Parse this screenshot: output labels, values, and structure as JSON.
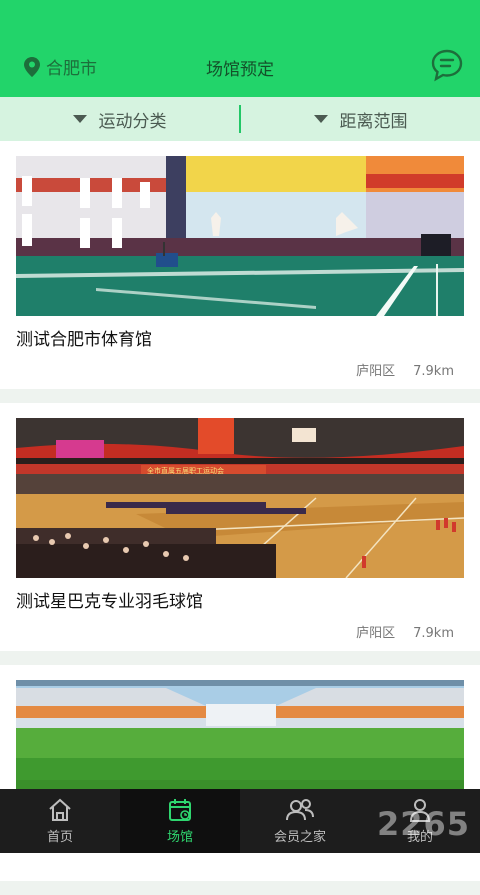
{
  "header": {
    "city": "合肥市",
    "title": "场馆预定"
  },
  "filters": {
    "sport_category": "运动分类",
    "distance_range": "距离范围"
  },
  "venues": [
    {
      "name": "测试合肥市体育馆",
      "district": "庐阳区",
      "distance": "7.9km"
    },
    {
      "name": "测试星巴克专业羽毛球馆",
      "district": "庐阳区",
      "distance": "7.9km"
    },
    {
      "name": "",
      "district": "",
      "distance": ""
    }
  ],
  "photo_banner": "全市直属五届职工运动会",
  "tabs": [
    {
      "label": "首页",
      "icon": "home-icon"
    },
    {
      "label": "场馆",
      "icon": "calendar-icon"
    },
    {
      "label": "会员之家",
      "icon": "members-icon"
    },
    {
      "label": "我的",
      "icon": "user-icon"
    }
  ],
  "watermark": "2265",
  "colors": {
    "accent": "#22d46a",
    "tab_active": "#2fd66f",
    "tabbar_bg": "#1d1d1d"
  }
}
